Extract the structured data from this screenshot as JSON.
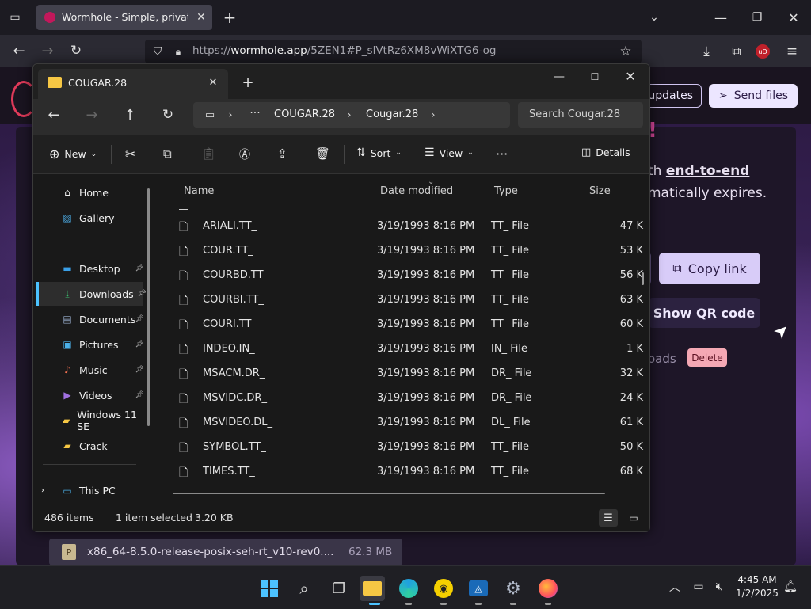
{
  "browser": {
    "tab_title": "Wormhole - Simple, private file",
    "url_prefix": "https://",
    "url_domain": "wormhole.app",
    "url_path": "/5ZEN1#P_slVtRz6XM8vWiXTG6-og",
    "ext_badge": "uD"
  },
  "webpage": {
    "updates_label": "updates",
    "send_files_label": "Send files",
    "headline_fragment": "th",
    "headline_bold": "end-to-end",
    "subline_fragment": "matically expires.",
    "copy_link_label": "Copy link",
    "qr_label": "Show QR code",
    "downloads_fragment": "oads",
    "delete_label": "Delete"
  },
  "explorer": {
    "tab_title": "COUGAR.28",
    "breadcrumb": [
      "COUGAR.28",
      "Cougar.28"
    ],
    "search_placeholder": "Search Cougar.28",
    "commands": {
      "new_label": "New",
      "sort_label": "Sort",
      "view_label": "View",
      "details_label": "Details"
    },
    "nav": [
      {
        "label": "Home",
        "icon": "home-icon",
        "pinned": false
      },
      {
        "label": "Gallery",
        "icon": "gallery-icon",
        "pinned": false
      },
      {
        "label": "Desktop",
        "icon": "desktop-icon",
        "pinned": true
      },
      {
        "label": "Downloads",
        "icon": "downloads-icon",
        "pinned": true
      },
      {
        "label": "Documents",
        "icon": "documents-icon",
        "pinned": true
      },
      {
        "label": "Pictures",
        "icon": "pictures-icon",
        "pinned": true
      },
      {
        "label": "Music",
        "icon": "music-icon",
        "pinned": true
      },
      {
        "label": "Videos",
        "icon": "videos-icon",
        "pinned": true
      },
      {
        "label": "Windows 11 SE",
        "icon": "folder-icon",
        "pinned": false
      },
      {
        "label": "Crack",
        "icon": "folder-icon",
        "pinned": false
      },
      {
        "label": "This PC",
        "icon": "this-pc-icon",
        "pinned": false
      }
    ],
    "columns": {
      "name": "Name",
      "date": "Date modified",
      "type": "Type",
      "size": "Size"
    },
    "files": [
      {
        "name": "ARIALI.TT_",
        "date": "3/19/1993 8:16 PM",
        "type": "TT_ File",
        "size": "47 K"
      },
      {
        "name": "COUR.TT_",
        "date": "3/19/1993 8:16 PM",
        "type": "TT_ File",
        "size": "53 K"
      },
      {
        "name": "COURBD.TT_",
        "date": "3/19/1993 8:16 PM",
        "type": "TT_ File",
        "size": "56 K"
      },
      {
        "name": "COURBI.TT_",
        "date": "3/19/1993 8:16 PM",
        "type": "TT_ File",
        "size": "63 K"
      },
      {
        "name": "COURI.TT_",
        "date": "3/19/1993 8:16 PM",
        "type": "TT_ File",
        "size": "60 K"
      },
      {
        "name": "INDEO.IN_",
        "date": "3/19/1993 8:16 PM",
        "type": "IN_ File",
        "size": "1 K"
      },
      {
        "name": "MSACM.DR_",
        "date": "3/19/1993 8:16 PM",
        "type": "DR_ File",
        "size": "32 K"
      },
      {
        "name": "MSVIDC.DR_",
        "date": "3/19/1993 8:16 PM",
        "type": "DR_ File",
        "size": "24 K"
      },
      {
        "name": "MSVIDEO.DL_",
        "date": "3/19/1993 8:16 PM",
        "type": "DL_ File",
        "size": "61 K"
      },
      {
        "name": "SYMBOL.TT_",
        "date": "3/19/1993 8:16 PM",
        "type": "TT_ File",
        "size": "50 K"
      },
      {
        "name": "TIMES.TT_",
        "date": "3/19/1993 8:16 PM",
        "type": "TT_ File",
        "size": "68 K"
      }
    ],
    "status": {
      "count": "486 items",
      "selected": "1 item selected",
      "selected_size": "3.20 KB"
    }
  },
  "download": {
    "filename": "x86_64-8.5.0-release-posix-seh-rt_v10-rev0....",
    "size": "62.3 MB"
  },
  "taskbar": {
    "time": "4:45 AM",
    "date": "1/2/2025"
  },
  "colors": {
    "accent": "#4cc2ff",
    "folder": "#f6c744",
    "firefox_bg": "#1c1b22",
    "web_button": "#ece6ff"
  }
}
